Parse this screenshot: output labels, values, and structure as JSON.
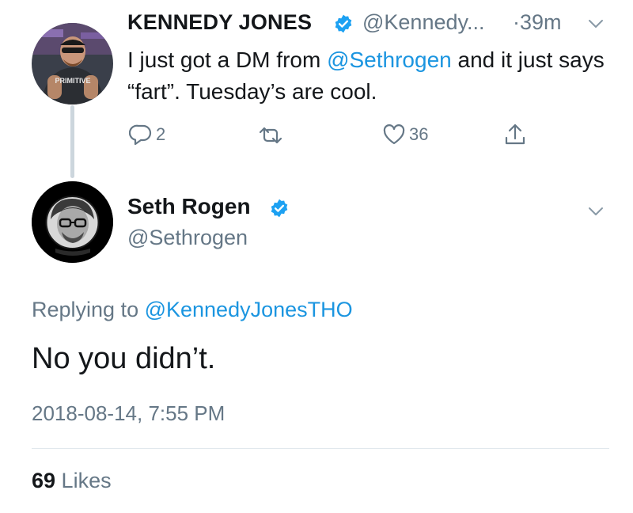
{
  "tweet": {
    "author_name": "KENNEDY JONES",
    "author_handle": "@Kennedy...",
    "time": "·39m",
    "text_part1": "I just got a DM from ",
    "text_mention": "@Sethrogen",
    "text_part2": " and it just says “fart”.  Tuesday’s are cool.",
    "avatar_shirt_text": "PRIMITIVE",
    "reply_count": "2",
    "like_count": "36"
  },
  "reply": {
    "author_name": "Seth Rogen",
    "author_handle": "@Sethrogen",
    "replying_prefix": "Replying to ",
    "replying_to": "@KennedyJonesTHO",
    "text": "No you didn’t.",
    "timestamp": "2018-08-14, 7:55 PM",
    "likes_count": "69",
    "likes_label": " Likes"
  },
  "colors": {
    "link": "#1b95e0",
    "verified": "#1da1f2",
    "secondary_text": "#657786"
  }
}
